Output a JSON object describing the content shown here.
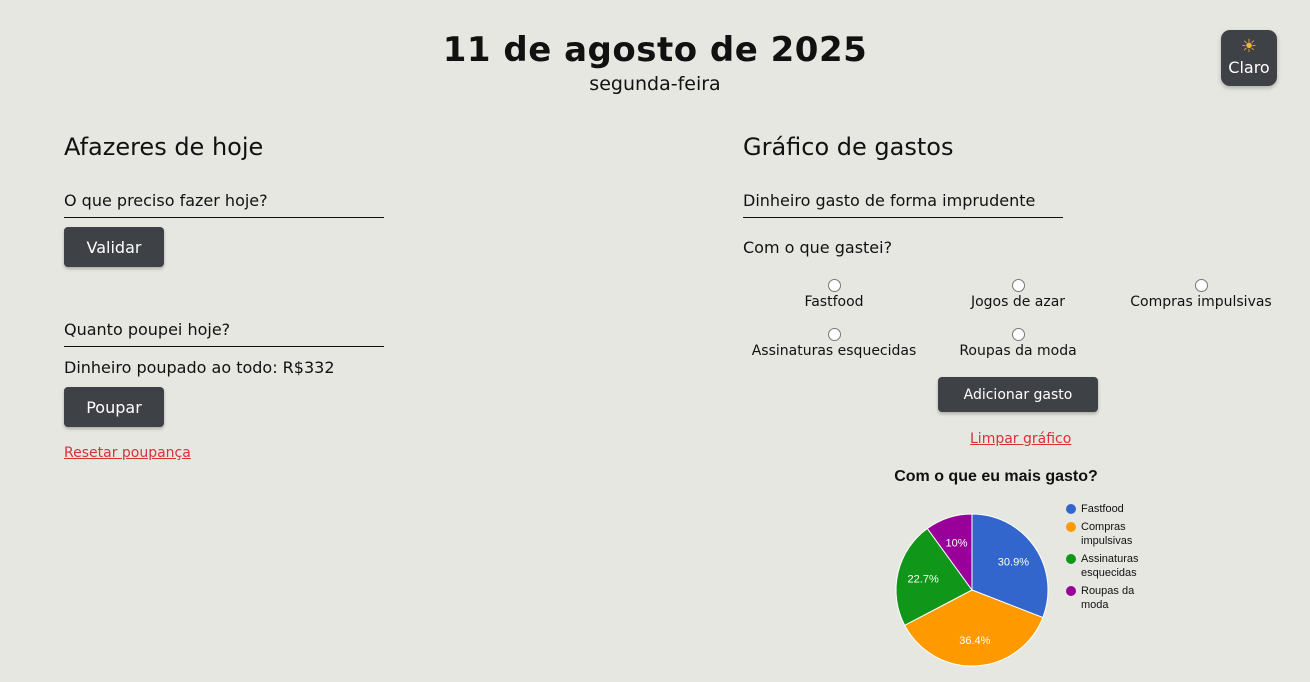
{
  "header": {
    "date": "11 de agosto de 2025",
    "weekday": "segunda-feira"
  },
  "theme_toggle": {
    "icon": "sun-icon",
    "label": "Claro"
  },
  "todos": {
    "title": "Afazeres de hoje",
    "placeholder": "O que preciso fazer hoje?",
    "validate_label": "Validar"
  },
  "savings": {
    "placeholder": "Quanto poupei hoje?",
    "total_text": "Dinheiro poupado ao todo: R$332",
    "save_label": "Poupar",
    "reset_label": "Resetar poupança"
  },
  "expenses": {
    "title": "Gráfico de gastos",
    "amount_placeholder": "Dinheiro gasto de forma imprudente",
    "question": "Com o que gastei?",
    "options": [
      "Fastfood",
      "Jogos de azar",
      "Compras impulsivas",
      "Assinaturas esquecidas",
      "Roupas da moda"
    ],
    "add_label": "Adicionar gasto",
    "clear_label": "Limpar gráfico"
  },
  "chart_data": {
    "type": "pie",
    "title": "Com o que eu mais gasto?",
    "categories": [
      "Fastfood",
      "Compras impulsivas",
      "Assinaturas esquecidas",
      "Roupas da moda"
    ],
    "values": [
      30.9,
      36.4,
      22.7,
      10
    ],
    "labels": [
      "30.9%",
      "36.4%",
      "22.7%",
      "10%"
    ],
    "colors": [
      "#3366cc",
      "#ff9900",
      "#109618",
      "#990099"
    ],
    "legend_position": "right",
    "legend_labels": [
      [
        "Fastfood"
      ],
      [
        "Compras",
        "impulsivas"
      ],
      [
        "Assinaturas",
        "esquecidas"
      ],
      [
        "Roupas da",
        "moda"
      ]
    ]
  }
}
